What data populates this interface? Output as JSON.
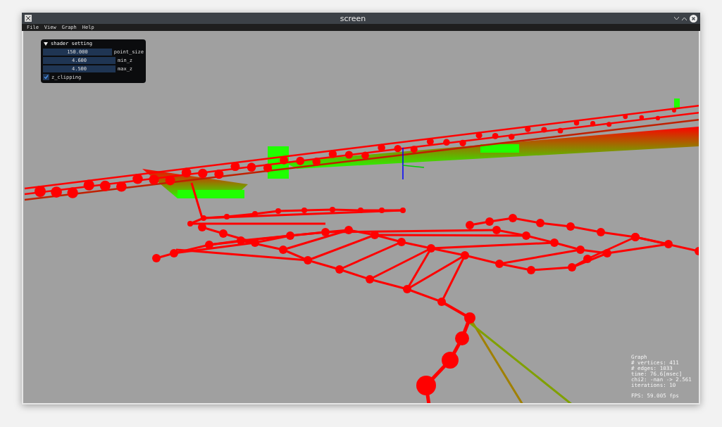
{
  "window": {
    "title": "screen"
  },
  "menu": [
    {
      "label": "File"
    },
    {
      "label": "View"
    },
    {
      "label": "Graph"
    },
    {
      "label": "Help"
    }
  ],
  "panel": {
    "title": "shader setting",
    "expanded": true,
    "fields": [
      {
        "value": "150.000",
        "label": "point_size"
      },
      {
        "value": "4.600",
        "label": "min_z"
      },
      {
        "value": "4.500",
        "label": "max_z"
      }
    ],
    "checkbox": {
      "label": "z_clipping",
      "checked": true
    }
  },
  "stats": {
    "lines": [
      "Graph",
      "# vertices: 411",
      "# edges: 1033",
      "time: 76.6[msec]",
      "chi2: -nan -> 2.561",
      "iterations: 10"
    ],
    "fps": "FPS: 59.005 fps"
  }
}
